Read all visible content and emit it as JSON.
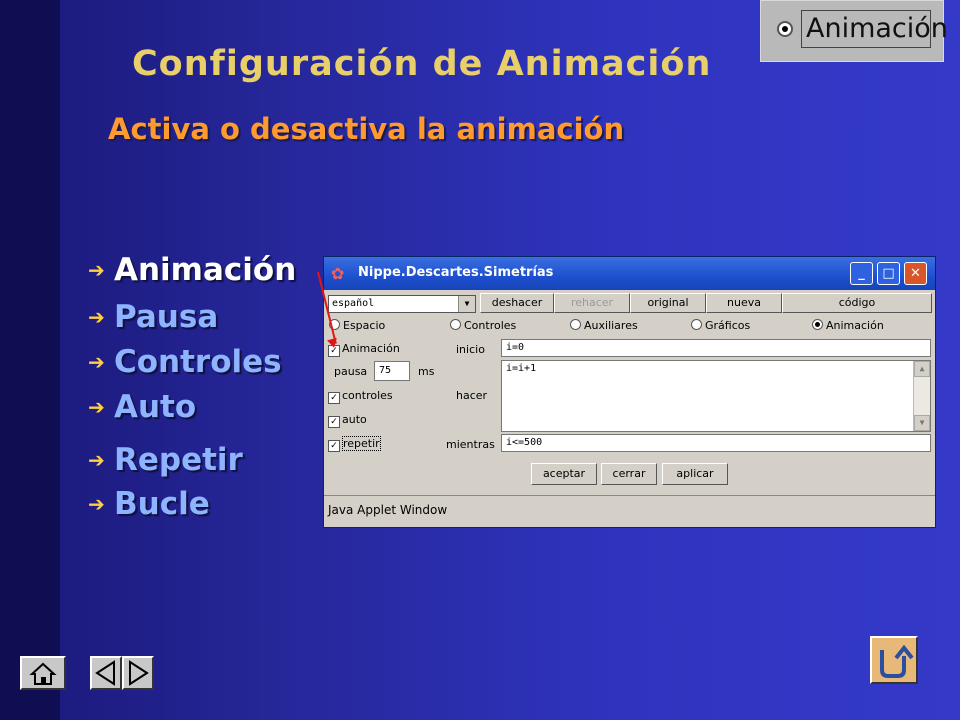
{
  "slide": {
    "title": "Configuración de Animación",
    "subtitle": "Activa o desactiva la animación"
  },
  "corner_badge": {
    "label": "Animación"
  },
  "menu": [
    {
      "arrow": "è",
      "label": "Animación",
      "active": true
    },
    {
      "arrow": "è",
      "label": "Pausa"
    },
    {
      "arrow": "è",
      "label": "Controles"
    },
    {
      "arrow": "è",
      "label": "Auto"
    },
    {
      "arrow": "è",
      "label": "Repetir"
    },
    {
      "arrow": "è",
      "label": "Bucle"
    }
  ],
  "window": {
    "title": "Nippe.Descartes.Simetrías",
    "language": "español",
    "toolbar": [
      "deshacer",
      "rehacer",
      "original",
      "nueva",
      "código"
    ],
    "tabs": [
      "Espacio",
      "Controles",
      "Auxiliares",
      "Gráficos",
      "Animación"
    ],
    "selected_tab": "Animación",
    "animacion_label": "Animación",
    "pausa_label": "pausa",
    "pausa_value": "75",
    "ms_label": "ms",
    "controles_label": "controles",
    "auto_label": "auto",
    "repetir_label": "repetir",
    "inicio_label": "inicio",
    "inicio_value": "i=0",
    "hacer_label": "hacer",
    "hacer_value": "i=i+1",
    "mientras_label": "mientras",
    "mientras_value": "i<=500",
    "buttons": [
      "aceptar",
      "cerrar",
      "aplicar"
    ],
    "status": "Java Applet Window"
  },
  "colors": {
    "title": "#e8cf6a",
    "subtitle": "#ff9a2e",
    "menu_text": "#8fb4ff",
    "titlebar": "#1d50cf"
  }
}
